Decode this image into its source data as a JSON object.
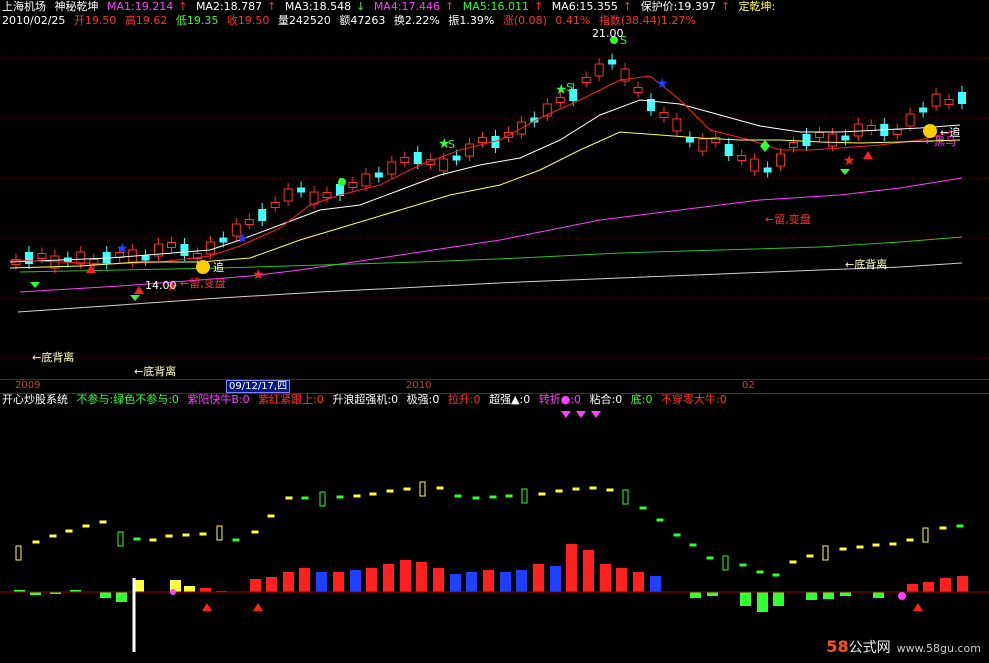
{
  "header": {
    "stock": "上海机场",
    "formula": "神秘乾坤",
    "ma1": "MA1:19.214",
    "ma2": "MA2:18.787",
    "ma3": "MA3:18.548",
    "ma4": "MA4:17.446",
    "ma5": "MA5:16.011",
    "ma6": "MA6:15.355",
    "protect": "保护价:19.397",
    "dingqk": "定乾坤:",
    "date": "2010/02/25",
    "open": "开19.50",
    "high": "高19.62",
    "low": "低19.35",
    "close": "收19.50",
    "vol": "量242520",
    "amt": "额47263",
    "turn": "换2.22%",
    "amp": "振1.39%",
    "chg": "涨(0.08)",
    "chg_pct": "0.41%",
    "index": "指数(38.44)1.27%"
  },
  "main_labels": {
    "price_hi": "21.00",
    "price_lo": "14.00",
    "s1": "S",
    "s2": "S",
    "s3": "S",
    "div1": "←底背离",
    "div2": "←底背离",
    "div3": "←底背离",
    "zhui1": "追",
    "zhui2": "←追",
    "bs1": "←留,变盘",
    "bs2": "←留,变盘",
    "heima": "←黑马"
  },
  "date_axis": {
    "y2009": "2009",
    "sel": "09/12/17,四",
    "y2010": "2010",
    "m02": "02"
  },
  "indicator": {
    "name": "开心炒股系统",
    "a": "不参与:绿色不参与:0",
    "b": "紫阳快牛B:0",
    "c": "紫红紧跟上:0",
    "d": "升浪超强机:0",
    "e": "极强:0",
    "f": "拉升:0",
    "g": "超强▲:0",
    "h": "转折●:0",
    "i": "粘合:0",
    "j": "底:0",
    "k": "不穿零大牛:0"
  },
  "watermark": {
    "n": "58",
    "t": "公式网",
    "site": "www.58gu.com"
  },
  "colors": {
    "up": "#ff3030",
    "down": "#40ffff",
    "ma_white": "#ffffff",
    "ma_yellow": "#ffff40",
    "ma_magenta": "#ff40ff",
    "ma_green": "#30d030"
  }
}
